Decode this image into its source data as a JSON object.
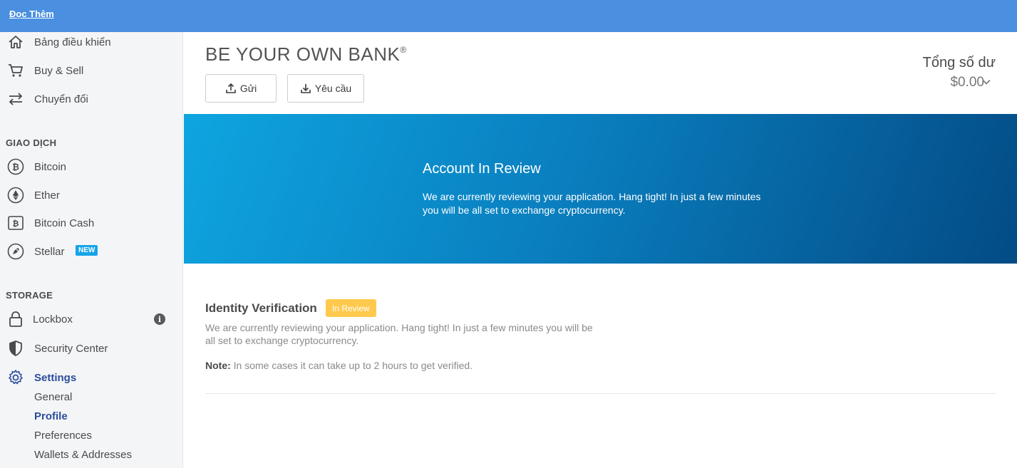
{
  "topbar": {
    "link_label": "Đọc Thêm",
    "background_color": "#4a8fe0"
  },
  "sidebar": {
    "nav": [
      {
        "label": "Bảng điều khiển",
        "icon": "home-icon"
      },
      {
        "label": "Buy & Sell",
        "icon": "cart-icon"
      },
      {
        "label": "Chuyển đổi",
        "icon": "swap-icon"
      }
    ],
    "transactions_title": "GIAO DỊCH",
    "transactions": [
      {
        "label": "Bitcoin",
        "icon": "bitcoin-icon"
      },
      {
        "label": "Ether",
        "icon": "ether-icon"
      },
      {
        "label": "Bitcoin Cash",
        "icon": "bitcoin-cash-icon"
      },
      {
        "label": "Stellar",
        "icon": "stellar-icon",
        "badge": "NEW"
      }
    ],
    "storage_title": "STORAGE",
    "storage": [
      {
        "label": "Lockbox",
        "icon": "lock-icon",
        "info": "i"
      },
      {
        "label": "Security Center",
        "icon": "shield-icon"
      },
      {
        "label": "Settings",
        "icon": "gear-icon"
      }
    ],
    "settings_sub": [
      {
        "label": "General"
      },
      {
        "label": "Profile"
      },
      {
        "label": "Preferences"
      },
      {
        "label": "Wallets & Addresses"
      }
    ],
    "active_color": "#2c4d9d",
    "badge_color": "#16a4e8"
  },
  "header": {
    "title": "BE YOUR OWN BANK",
    "title_mark": "®",
    "send_label": "Gửi",
    "request_label": "Yêu cầu",
    "balance_label": "Tổng số dư",
    "balance_value": "$0.00"
  },
  "banner": {
    "title": "Account In Review",
    "text": "We are currently reviewing your application. Hang tight! In just a few minutes you will be all set to exchange cryptocurrency."
  },
  "identity": {
    "title": "Identity Verification",
    "status": "In Review",
    "status_color": "#ffc94d",
    "description": "We are currently reviewing your application. Hang tight! In just a few minutes you will be all set to exchange cryptocurrency.",
    "note_label": "Note:",
    "note_text": " In some cases it can take up to 2 hours to get verified."
  }
}
